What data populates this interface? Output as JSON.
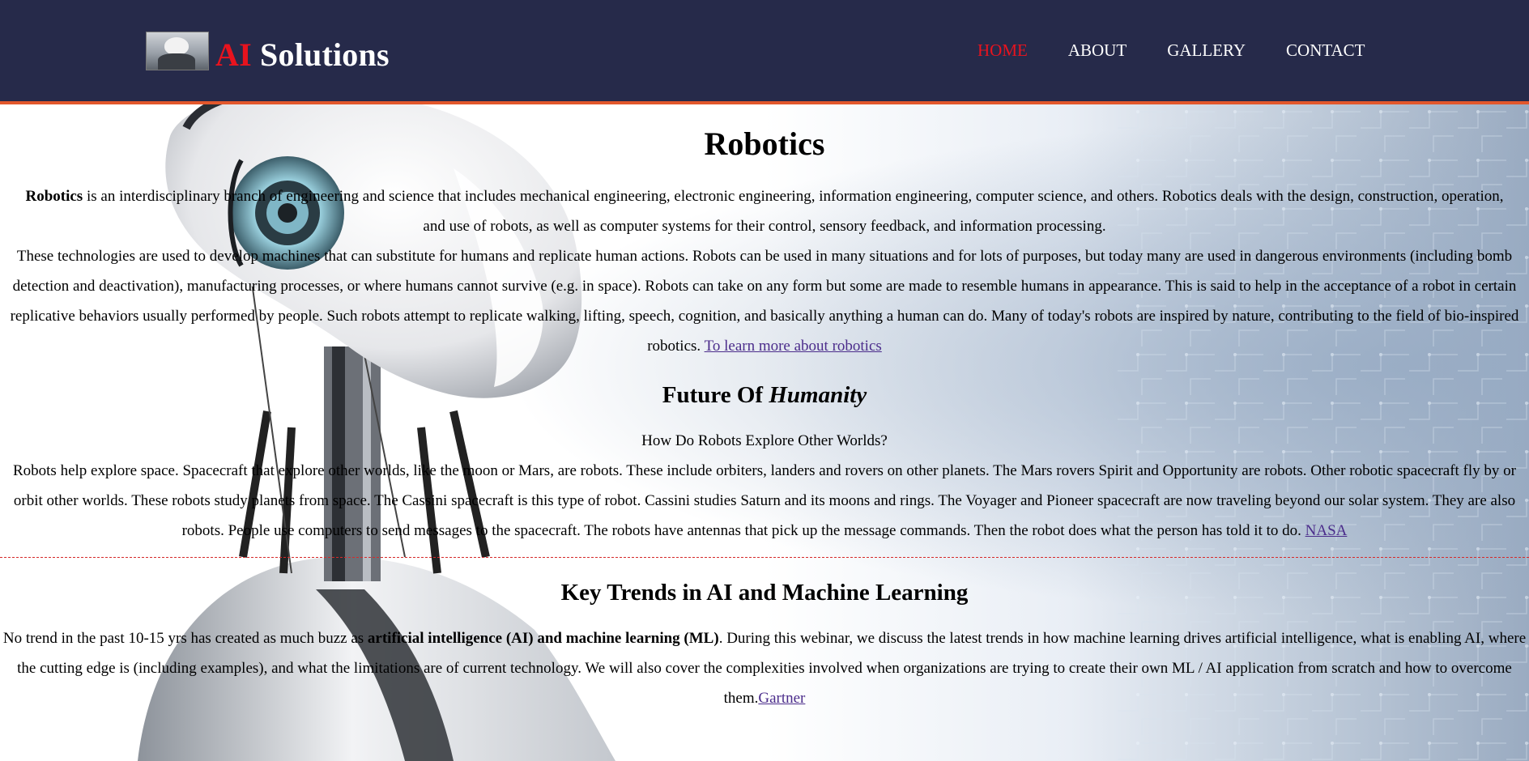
{
  "header": {
    "brand_ai": "AI",
    "brand_rest": " Solutions",
    "nav": [
      {
        "label": "HOME",
        "active": true
      },
      {
        "label": "ABOUT",
        "active": false
      },
      {
        "label": "GALLERY",
        "active": false
      },
      {
        "label": "CONTACT",
        "active": false
      }
    ]
  },
  "robotics": {
    "title": "Robotics",
    "p1_bold": "Robotics",
    "p1_rest": " is an interdisciplinary branch of engineering and science that includes mechanical engineering, electronic engineering, information engineering, computer science, and others. Robotics deals with the design, construction, operation, and use of robots, as well as computer systems for their control, sensory feedback, and information processing.",
    "p2": "These technologies are used to develop machines that can substitute for humans and replicate human actions. Robots can be used in many situations and for lots of purposes, but today many are used in dangerous environments (including bomb detection and deactivation), manufacturing processes, or where humans cannot survive (e.g. in space). Robots can take on any form but some are made to resemble humans in appearance. This is said to help in the acceptance of a robot in certain replicative behaviors usually performed by people. Such robots attempt to replicate walking, lifting, speech, cognition, and basically anything a human can do. Many of today's robots are inspired by nature, contributing to the field of bio-inspired robotics. ",
    "link": "To learn more about robotics"
  },
  "future": {
    "title_plain": "Future Of ",
    "title_italic": "Humanity",
    "question": "How Do Robots Explore Other Worlds?",
    "body": "Robots help explore space. Spacecraft that explore other worlds, like the moon or Mars, are robots. These include orbiters, landers and rovers on other planets. The Mars rovers Spirit and Opportunity are robots. Other robotic spacecraft fly by or orbit other worlds. These robots study planets from space. The Cassini spacecraft is this type of robot. Cassini studies Saturn and its moons and rings. The Voyager and Pioneer spacecraft are now traveling beyond our solar system. They are also robots. People use computers to send messages to the spacecraft. The robots have antennas that pick up the message commands. Then the robot does what the person has told it to do. ",
    "link": "NASA"
  },
  "trends": {
    "title": "Key Trends in AI and Machine Learning",
    "pre": "No trend in the past 10-15 yrs has created as much buzz as ",
    "bold": "artificial intelligence (AI) and machine learning (ML)",
    "post": ". During this webinar, we discuss the latest trends in how machine learning drives artificial intelligence, what is enabling AI, where the cutting edge is (including examples), and what the limitations are of current technology. We will also cover the complexities involved when organizations are trying to create their own ML / AI application from scratch and how to overcome them.",
    "link": "Gartner"
  },
  "colors": {
    "header_bg": "#262a4a",
    "header_border": "#e2572c",
    "accent_red": "#e8131e",
    "link": "#4b2c8b",
    "divider": "#d62a2a"
  }
}
